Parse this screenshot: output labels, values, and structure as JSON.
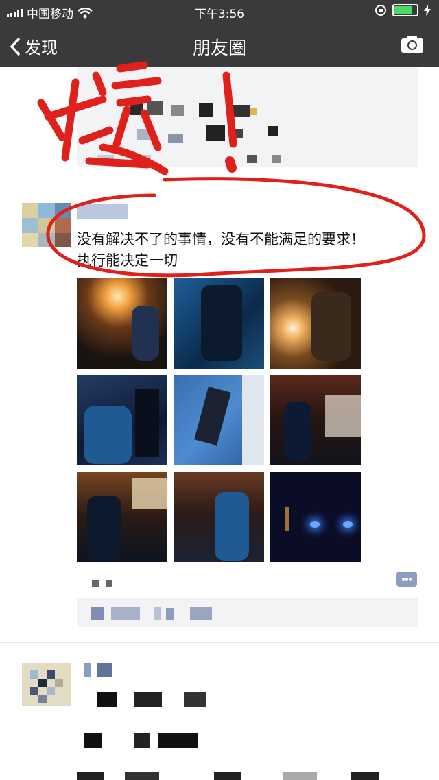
{
  "status_bar": {
    "carrier": "中国移动",
    "time": "下午3:56"
  },
  "nav": {
    "back_label": "发现",
    "title": "朋友圈"
  },
  "post": {
    "text_line1": "没有解决不了的事情，没有不能满足的要求！",
    "text_line2": "执行能决定一切"
  },
  "colors": {
    "bar_bg": "#3a3a3c",
    "link_blue": "#576b95",
    "highlight_red": "#e0201b"
  },
  "icons": [
    "back-chevron-icon",
    "camera-icon",
    "wifi-icon",
    "battery-icon",
    "comment-icon"
  ]
}
